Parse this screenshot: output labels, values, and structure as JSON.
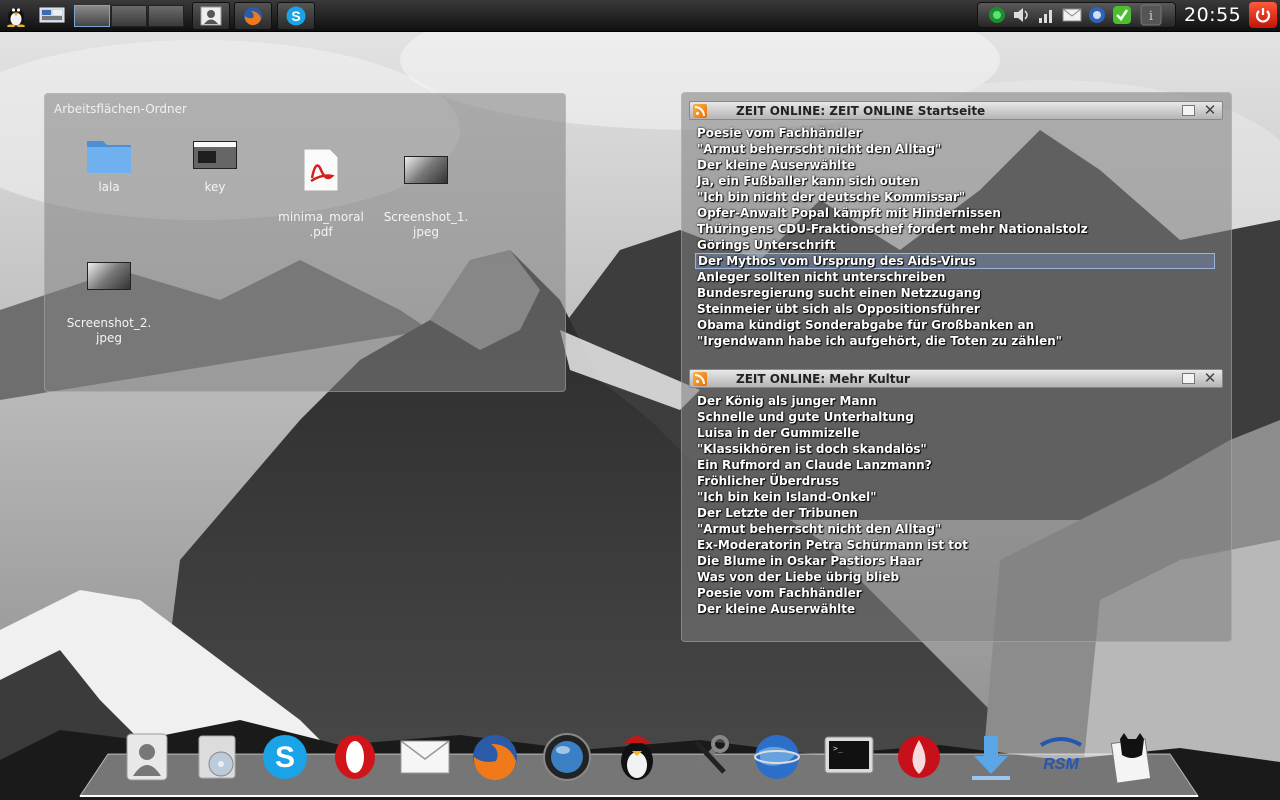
{
  "top_panel": {
    "menu_icon": "tux-icon",
    "show_desktop_icon": "show-desktop-icon",
    "workspaces": [
      "workspace-1",
      "workspace-2",
      "workspace-3",
      "workspace-4"
    ],
    "tasks": [
      "contacts-task",
      "firefox-task",
      "skype-task"
    ],
    "tray_icons": [
      "network-icon",
      "volume-icon",
      "wifi-icon",
      "mail-icon",
      "update-icon",
      "security-check-icon",
      "info-icon"
    ],
    "clock": "20:55",
    "power_icon": "power-icon"
  },
  "folder_widget": {
    "title": "Arbeitsflächen-Ordner",
    "icons": [
      {
        "label": "lala",
        "icon": "folder-icon"
      },
      {
        "label": "key",
        "icon": "screenshot-thumbnail-icon"
      },
      {
        "label": "minima_moral\n.pdf",
        "icon": "pdf-icon"
      },
      {
        "label": "Screenshot_1.\njpeg",
        "icon": "image-file-icon"
      },
      {
        "label": "Screenshot_2.\njpeg",
        "icon": "image-file-icon"
      }
    ]
  },
  "rss_widget": {
    "feeds": [
      {
        "title": "ZEIT ONLINE: ZEIT ONLINE Startseite",
        "items": [
          "Poesie vom Fachhändler",
          "\"Armut beherrscht nicht den Alltag\"",
          "Der kleine Auserwählte",
          "Ja, ein Fußballer kann sich outen",
          "\"Ich bin nicht der deutsche Kommissar\"",
          "Opfer-Anwalt Popal kämpft mit Hindernissen",
          "Thüringens CDU-Fraktionschef fordert mehr Nationalstolz",
          "Görings Unterschrift",
          "Der Mythos vom Ursprung des Aids-Virus",
          "Anleger sollten nicht unterschreiben",
          "Bundesregierung sucht einen Netzzugang",
          "Steinmeier übt sich als Oppositionsführer",
          "Obama kündigt Sonderabgabe für Großbanken an",
          "\"Irgendwann habe ich aufgehört, die Toten zu zählen\""
        ],
        "selected_item": "Der Mythos vom Ursprung des Aids-Virus"
      },
      {
        "title": "ZEIT ONLINE: Mehr Kultur",
        "items": [
          "Der König als junger Mann",
          "Schnelle und gute Unterhaltung",
          "Luisa in der Gummizelle",
          "\"Klassikhören ist doch skandalös\"",
          "Ein Rufmord an Claude Lanzmann?",
          "Fröhlicher Überdruss",
          "\"Ich bin kein Island-Onkel\"",
          "Der Letzte der Tribunen",
          "\"Armut beherrscht nicht den Alltag\"",
          "Ex-Moderatorin Petra Schürmann ist tot",
          "Die Blume in Oskar Pastiors Haar",
          "Was von der Liebe übrig blieb",
          "Poesie vom Fachhändler",
          "Der kleine Auserwählte"
        ]
      }
    ]
  },
  "dock": {
    "items": [
      "contacts-icon",
      "disk-burner-icon",
      "skype-icon",
      "opera-icon",
      "mail-icon",
      "firefox-icon",
      "media-player-icon",
      "tux-games-icon",
      "system-tools-icon",
      "google-earth-icon",
      "terminal-icon",
      "flash-icon",
      "download-icon",
      "rsm-icon",
      "cat-notes-icon"
    ]
  },
  "colors": {
    "panel_bg": "#1a1a1a",
    "widget_bg": "#808080",
    "feed_header": "#d0d0d0",
    "selection": "#9ab4dc",
    "power": "#e0231a",
    "rss_orange": "#f08a1c"
  }
}
